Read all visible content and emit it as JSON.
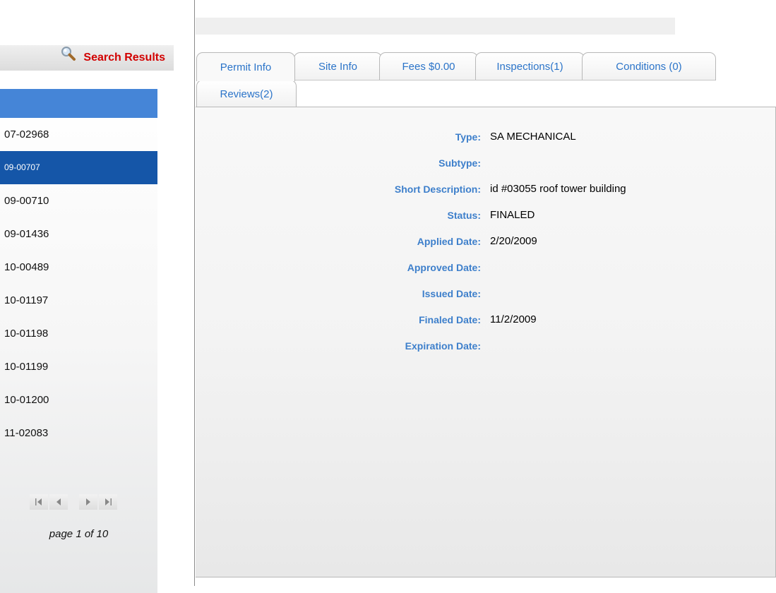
{
  "sidebar": {
    "search_results_label": "Search Results",
    "search_icon": "magnifier-icon",
    "results": [
      {
        "label": "07-02968",
        "selected": false
      },
      {
        "label": "09-00707",
        "selected": true
      },
      {
        "label": "09-00710",
        "selected": false
      },
      {
        "label": "09-01436",
        "selected": false
      },
      {
        "label": "10-00489",
        "selected": false
      },
      {
        "label": "10-01197",
        "selected": false
      },
      {
        "label": "10-01198",
        "selected": false
      },
      {
        "label": "10-01199",
        "selected": false
      },
      {
        "label": "10-01200",
        "selected": false
      },
      {
        "label": "11-02083",
        "selected": false
      }
    ],
    "pager": {
      "first_icon": "first-page-icon",
      "prev_icon": "previous-page-icon",
      "next_icon": "next-page-icon",
      "last_icon": "last-page-icon",
      "page_text": "page 1 of 10"
    }
  },
  "tabs": {
    "row1": [
      {
        "label": "Permit Info",
        "active": true
      },
      {
        "label": "Site Info",
        "active": false
      },
      {
        "label": "Fees $0.00",
        "active": false
      },
      {
        "label": "Inspections(1)",
        "active": false
      },
      {
        "label": "Conditions (0)",
        "active": false
      }
    ],
    "row2": [
      {
        "label": "Reviews(2)",
        "active": false
      }
    ]
  },
  "permit": {
    "fields": [
      {
        "label": "Type:",
        "value": "SA MECHANICAL"
      },
      {
        "label": "Subtype:",
        "value": ""
      },
      {
        "label": "Short Description:",
        "value": "id #03055 roof tower building"
      },
      {
        "label": "Status:",
        "value": "FINALED"
      },
      {
        "label": "Applied Date:",
        "value": "2/20/2009"
      },
      {
        "label": "Approved Date:",
        "value": ""
      },
      {
        "label": "Issued Date:",
        "value": ""
      },
      {
        "label": "Finaled Date:",
        "value": "11/2/2009"
      },
      {
        "label": "Expiration Date:",
        "value": ""
      }
    ]
  },
  "colors": {
    "accent_blue": "#4585d7",
    "selected_blue": "#1556a8",
    "label_blue": "#3d7fcb",
    "search_red": "#d20000"
  }
}
